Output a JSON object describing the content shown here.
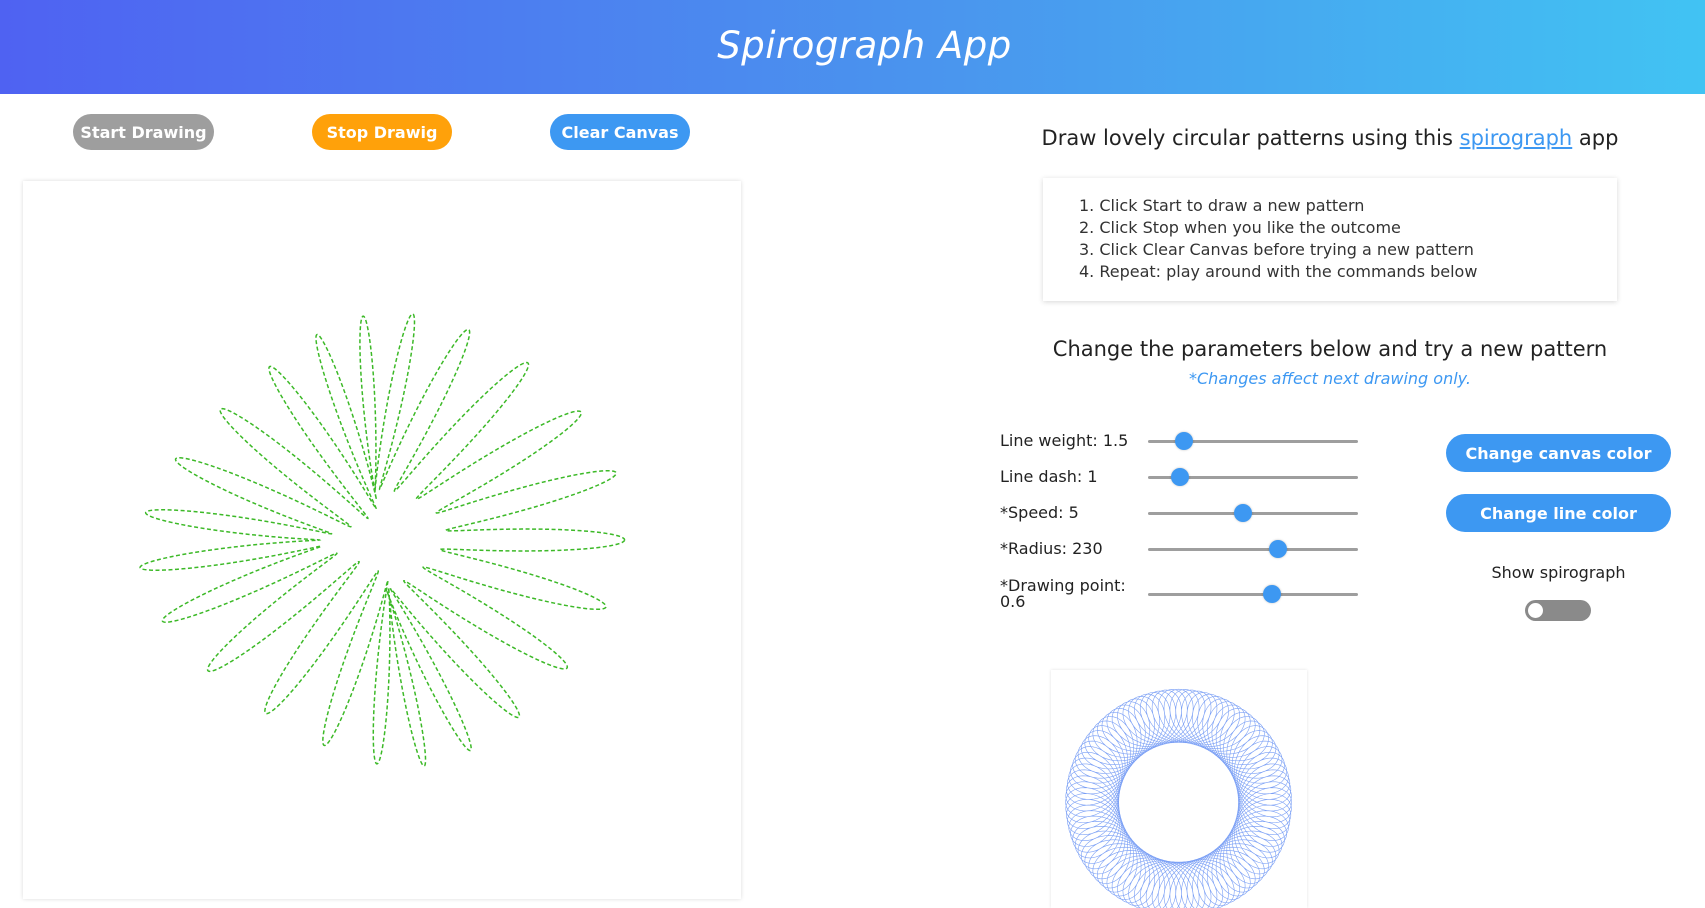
{
  "app": {
    "title": "Spirograph App"
  },
  "controls": {
    "start_label": "Start Drawing",
    "stop_label": "Stop Drawig",
    "clear_label": "Clear Canvas"
  },
  "intro": {
    "text_before": "Draw lovely circular patterns using this ",
    "link_text": "spirograph",
    "text_after": " app"
  },
  "instructions": [
    "1. Click Start to draw a new pattern",
    "2. Click Stop when you like the outcome",
    "3. Click Clear Canvas before trying a new pattern",
    "4. Repeat: play around with the commands below"
  ],
  "parameters": {
    "title": "Change the parameters below and try a new pattern",
    "note": "*Changes affect next drawing only.",
    "sliders": [
      {
        "label": "Line weight: 1.5",
        "value_fraction": 0.17
      },
      {
        "label": "Line dash: 1",
        "value_fraction": 0.15
      },
      {
        "label": "*Speed: 5",
        "value_fraction": 0.45
      },
      {
        "label": "*Radius: 230",
        "value_fraction": 0.62
      },
      {
        "label": "*Drawing point: 0.6",
        "value_fraction": 0.59
      }
    ]
  },
  "color_buttons": {
    "canvas_color_label": "Change canvas color",
    "line_color_label": "Change line color"
  },
  "spirograph_toggle": {
    "label": "Show spirograph",
    "on": false
  },
  "colors": {
    "header_start": "#4f62f2",
    "header_end": "#41c3f3",
    "accent": "#3d98f2",
    "start_button": "#9e9e9e",
    "stop_button": "#ffa10a",
    "pattern_line": "#3cb927",
    "preview_line": "#4d7ff2"
  }
}
